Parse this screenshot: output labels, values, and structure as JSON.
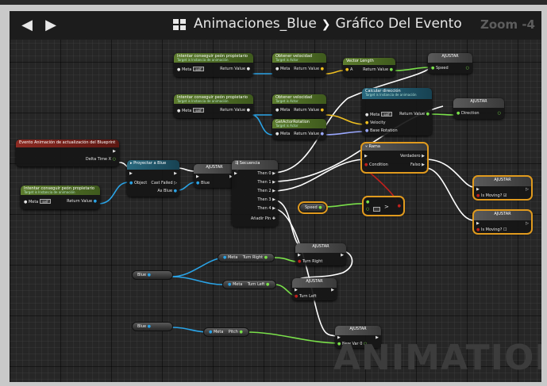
{
  "window": {
    "title_blueprint": "Animaciones_Blue",
    "separator": "❯",
    "title_graph": "Gráfico Del Evento",
    "zoom": "Zoom -4"
  },
  "nav": {
    "back_icon": "arrow-left-icon",
    "forward_icon": "arrow-right-icon"
  },
  "watermark": "ANIMATION",
  "nodes": {
    "pawn_owner_1": {
      "title": "Intentar conseguir peón propietario",
      "subtitle": "Target is Instancia de animación",
      "target": "Meta",
      "self": "self",
      "out": "Return Value"
    },
    "get_velocity_1": {
      "title": "Obtener velocidad",
      "subtitle": "Target is Actor",
      "target": "Meta",
      "out": "Return Value"
    },
    "vector_length": {
      "title": "Vector Length",
      "in": "A",
      "out": "Return Value"
    },
    "set_speed": {
      "title": "AJUSTAR",
      "pin": "Speed"
    },
    "pawn_owner_2": {
      "title": "Intentar conseguir peón propietario",
      "subtitle": "Target is Instancia de animación",
      "target": "Meta",
      "self": "self",
      "out": "Return Value"
    },
    "get_velocity_2": {
      "title": "Obtener velocidad",
      "subtitle": "Target is Actor",
      "target": "Meta",
      "out": "Return Value"
    },
    "get_rotation": {
      "title": "GetActorRotation",
      "subtitle": "Target is Actor",
      "target": "Meta",
      "out": "Return Value"
    },
    "calc_direction": {
      "title": "Calcular dirección",
      "subtitle": "Target is Instancia de animación",
      "target": "Meta",
      "self": "self",
      "velocity": "Velocity",
      "base_rotation": "Base Rotation",
      "out": "Return Value"
    },
    "set_direction": {
      "title": "AJUSTAR",
      "pin": "Direction"
    },
    "event_update": {
      "title": "Evento Animación de actualización del Blueprint",
      "out": "Delta Time X"
    },
    "pawn_owner_3": {
      "title": "Intentar conseguir peón propietario",
      "subtitle": "Target is Instancia de animación",
      "target": "Meta",
      "self": "self",
      "out": "Return Value"
    },
    "cast_blue": {
      "title": "Proyectar a Blue",
      "object": "Object",
      "failed": "Cast Failed",
      "as": "As Blue"
    },
    "set_blue": {
      "title": "AJUSTAR",
      "pin": "Blue"
    },
    "sequence": {
      "title": "Secuencia",
      "then": [
        "Then 0",
        "Then 1",
        "Then 2",
        "Then 3",
        "Then 4"
      ],
      "add_pin": "Añadir Pin"
    },
    "branch": {
      "title": "Rama",
      "condition": "Condition",
      "true": "Verdadero",
      "false": "Falso"
    },
    "set_moving_1": {
      "title": "AJUSTAR",
      "pin": "Is Moving?"
    },
    "set_moving_2": {
      "title": "AJUSTAR",
      "pin": "Is Moving?"
    },
    "get_speed": {
      "label": "Speed"
    },
    "compare": {
      "op": ">"
    },
    "blue_var_1": {
      "label": "Blue"
    },
    "get_turn_right": {
      "target": "Meta",
      "pin": "Turn Right"
    },
    "set_turn_right": {
      "title": "AJUSTAR",
      "pin": "Turn Right"
    },
    "get_turn_left": {
      "target": "Meta",
      "pin": "Turn Left"
    },
    "set_turn_left": {
      "title": "AJUSTAR",
      "pin": "Turn Left"
    },
    "blue_var_2": {
      "label": "Blue"
    },
    "get_pitch": {
      "target": "Meta",
      "pin": "Pitch"
    },
    "set_newvar": {
      "title": "AJUSTAR",
      "pin": "New Var 0"
    }
  },
  "colors": {
    "exec": "#ffffff",
    "object": "#2aa3e6",
    "vector": "#f0c020",
    "float": "#7ae04a",
    "rotator": "#9aa8ff",
    "bool": "#c0201c",
    "selection": "#e09a1e"
  }
}
